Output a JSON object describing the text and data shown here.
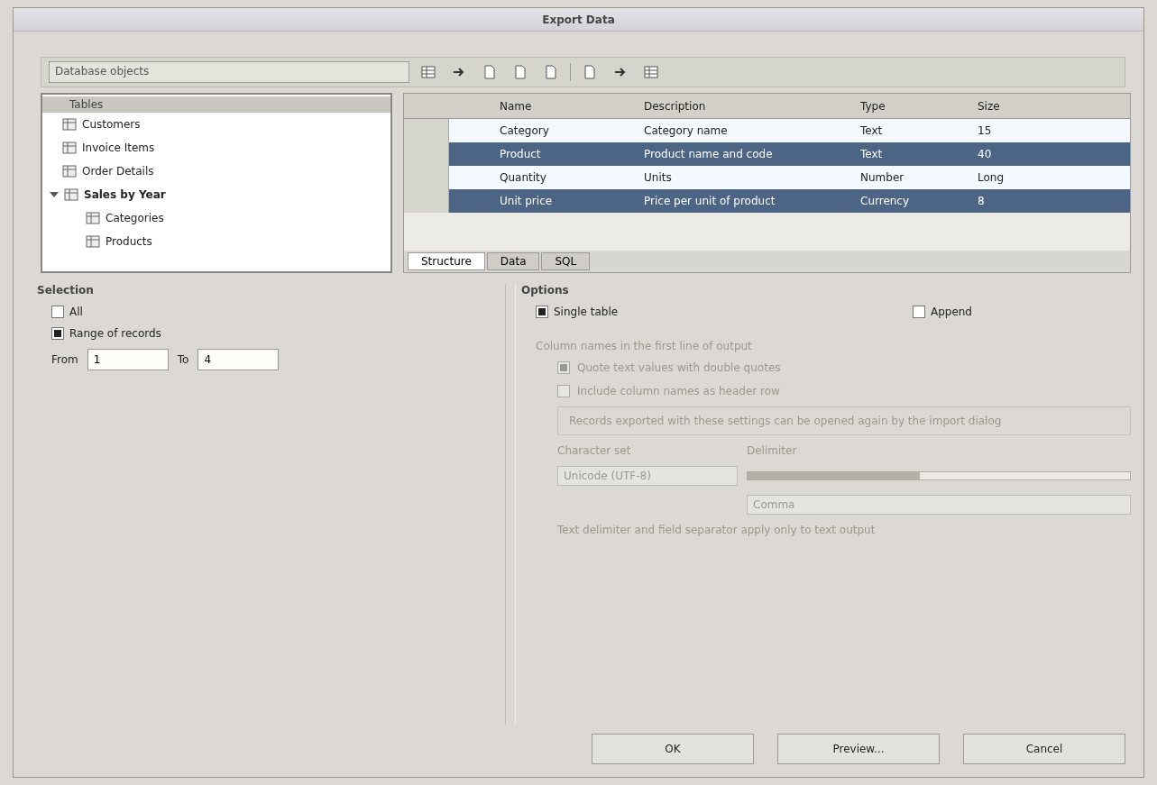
{
  "window": {
    "title": "Export Data"
  },
  "toolbar": {
    "source": "Database objects",
    "tools": [
      {
        "kind": "grid"
      },
      {
        "kind": "arrow"
      },
      {
        "kind": "doc"
      },
      {
        "kind": "doc"
      },
      {
        "kind": "doc"
      },
      {
        "kind": "sep"
      },
      {
        "kind": "doc"
      },
      {
        "kind": "arrow"
      },
      {
        "kind": "grid"
      }
    ]
  },
  "tree": {
    "heading": "Tables",
    "items": [
      {
        "label": "Customers",
        "selected": false
      },
      {
        "label": "Invoice Items",
        "selected": false
      },
      {
        "label": "Order Details",
        "selected": false
      },
      {
        "label": "Sales by Year",
        "selected": true,
        "expanded": true,
        "children": [
          {
            "label": "Categories",
            "selected": false
          },
          {
            "label": "Products",
            "selected": false
          }
        ]
      }
    ]
  },
  "table": {
    "columns": [
      "Name",
      "Description",
      "Type",
      "Size"
    ],
    "rows": [
      {
        "cells": [
          "Category",
          "Category name",
          "Text",
          "15"
        ],
        "selected": false
      },
      {
        "cells": [
          "Product",
          "Product name and code",
          "Text",
          "40"
        ],
        "selected": true
      },
      {
        "cells": [
          "Quantity",
          "Units",
          "Number",
          "Long"
        ],
        "selected": false
      },
      {
        "cells": [
          "Unit price",
          "Price per unit of product",
          "Currency",
          "8"
        ],
        "selected": true
      }
    ],
    "sheet_tabs": [
      {
        "label": "Structure",
        "selected": true
      },
      {
        "label": "Data",
        "selected": false
      },
      {
        "label": "SQL",
        "selected": false
      }
    ]
  },
  "selection": {
    "title": "Selection",
    "options": [
      {
        "label": "All",
        "selected": false
      },
      {
        "label": "Range of records",
        "selected": true
      }
    ],
    "from_label": "From",
    "to_label": "To",
    "from_value": "1",
    "to_value": "4"
  },
  "options": {
    "title": "Options",
    "modes": [
      {
        "label": "Single table",
        "selected": true
      },
      {
        "label": "Append",
        "selected": false
      }
    ],
    "section": "Column names in the first line of output",
    "checks": [
      {
        "label": "Quote text values with double quotes",
        "checked": true
      },
      {
        "label": "Include column names as header row",
        "checked": false
      }
    ],
    "note": "Records exported with these settings can be opened again by the import dialog",
    "encoding_label": "Character set",
    "encoding_value": "Unicode (UTF-8)",
    "delimiter_label": "Delimiter",
    "delimiter_value": "Comma",
    "level": 0.45,
    "footer": "Text delimiter and field separator apply only to text output"
  },
  "buttons": [
    {
      "label": "OK"
    },
    {
      "label": "Preview..."
    },
    {
      "label": "Cancel"
    }
  ]
}
